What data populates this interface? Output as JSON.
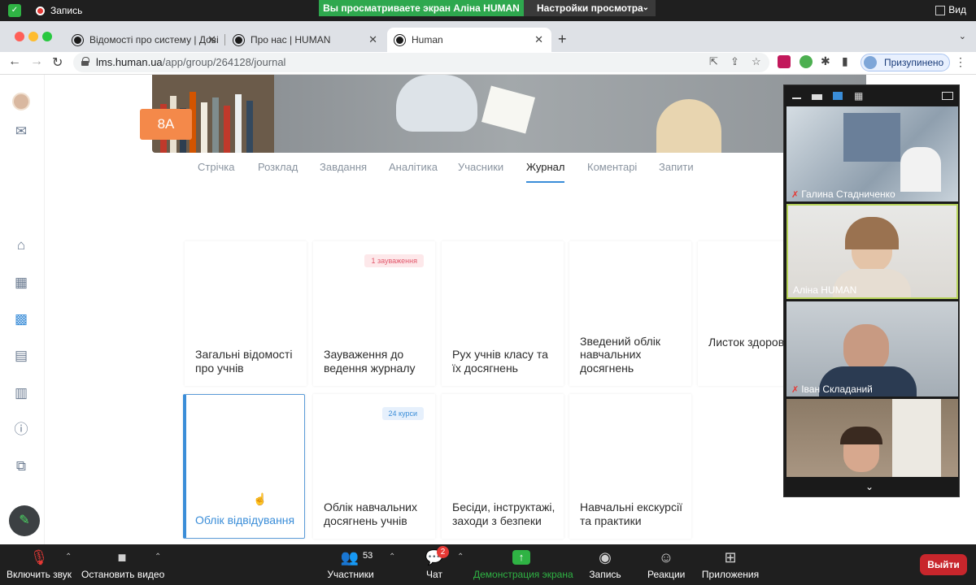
{
  "zoom_top": {
    "recording_label": "Запись",
    "share_banner": "Вы просматриваете экран Аліна HUMAN",
    "view_settings": "Настройки просмотра",
    "view_label": "Вид"
  },
  "browser": {
    "tabs": [
      {
        "title": "Відомості про систему | Дові",
        "active": false
      },
      {
        "title": "Про нас | HUMAN",
        "active": false
      },
      {
        "title": "Human",
        "active": true
      }
    ],
    "url_host": "lms.human.ua",
    "url_path": "/app/group/264128/journal",
    "profile_label": "Призупинено"
  },
  "app": {
    "class_badge": "8А",
    "subtabs": [
      "Стрічка",
      "Розклад",
      "Завдання",
      "Аналітика",
      "Учасники",
      "Журнал",
      "Коментарі",
      "Запити"
    ],
    "active_subtab": "Журнал",
    "cards_row1": [
      {
        "title": "Загальні відомості про учнів",
        "badge": ""
      },
      {
        "title": "Зауваження до ведення журналу",
        "badge": "1 зауваження"
      },
      {
        "title": "Рух учнів класу та їх досягнень",
        "badge": ""
      },
      {
        "title": "Зведений облік навчальних досягнень",
        "badge": ""
      },
      {
        "title": "Листок здоров",
        "badge": ""
      }
    ],
    "cards_row2": [
      {
        "title": "Облік відвідування",
        "badge": "",
        "selected": true
      },
      {
        "title": "Облік навчальних досягнень учнів",
        "badge": "24 курси"
      },
      {
        "title": "Бесіди, інструктажі, заходи з безпеки",
        "badge": ""
      },
      {
        "title": "Навчальні екскурсії та практики",
        "badge": ""
      }
    ]
  },
  "video_panel": {
    "participants": [
      {
        "name": "Галина Стадниченко",
        "muted": true
      },
      {
        "name": "Аліна HUMAN",
        "muted": false,
        "speaking": true
      },
      {
        "name": "Іван Складаний",
        "muted": true
      },
      {
        "name": "",
        "muted": false
      }
    ]
  },
  "zoom_bottom": {
    "mute": "Включить звук",
    "video": "Остановить видео",
    "participants": "Участники",
    "participants_count": "53",
    "chat": "Чат",
    "chat_badge": "2",
    "share": "Демонстрация экрана",
    "record": "Запись",
    "reactions": "Реакции",
    "apps": "Приложения",
    "leave": "Выйти"
  },
  "colors": {
    "accent": "#3a8dd8",
    "class_badge": "#f4894a",
    "share_green": "#2ea84e",
    "leave_red": "#c8262c"
  }
}
